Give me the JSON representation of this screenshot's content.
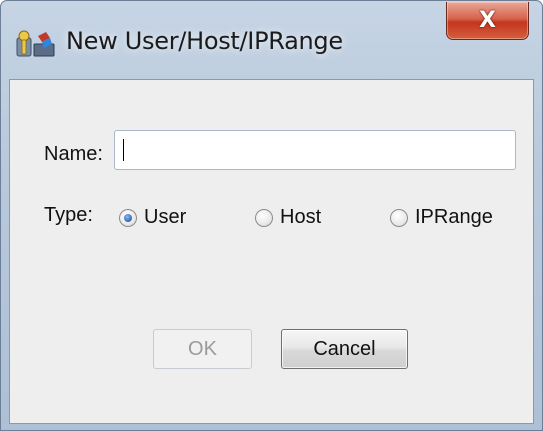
{
  "window": {
    "title": "New User/Host/IPRange",
    "close_symbol": "X",
    "app_icon": "user-host-key-icon"
  },
  "form": {
    "name_label": "Name:",
    "name_value": "",
    "type_label": "Type:",
    "type_options": [
      {
        "label": "User",
        "checked": true
      },
      {
        "label": "Host",
        "checked": false
      },
      {
        "label": "IPRange",
        "checked": false
      }
    ]
  },
  "buttons": {
    "ok_label": "OK",
    "ok_enabled": false,
    "cancel_label": "Cancel"
  },
  "colors": {
    "title_bar": "#b8c9dc",
    "close_button": "#c2361f",
    "client_bg": "#eeeeee",
    "radio_selected": "#2b66b8"
  }
}
